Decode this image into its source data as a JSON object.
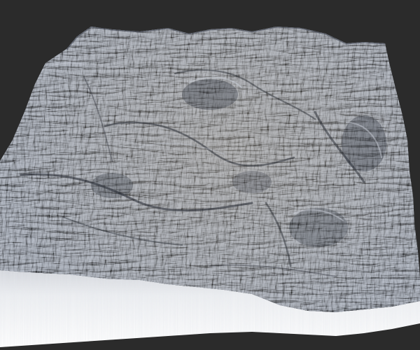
{
  "scene": {
    "subject": "terrain-heightmap-render",
    "colors": {
      "background": "#2b2b2b",
      "rock_light": "#a7aebb",
      "rock_mid": "#7f8898",
      "rock_dark": "#3d4350",
      "rock_shadow": "#1f232b",
      "ground_tint": "#b9a98f",
      "skirt_top": "#e4e6ea",
      "skirt_bottom": "#ffffff"
    }
  }
}
